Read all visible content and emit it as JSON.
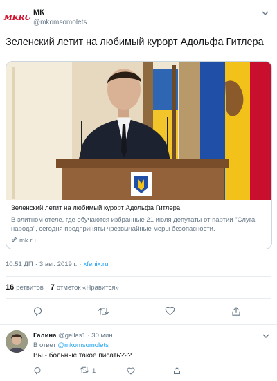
{
  "tweet": {
    "logo_text": "MKRU",
    "author_name": "МК",
    "author_handle": "@mkomsomolets",
    "text": "Зеленский летит на любимый курорт Адольфа Гитлера",
    "card": {
      "title": "Зеленский летит на любимый курорт Адольфа Гитлера",
      "description": "В элитном отеле, где обучаются избранные 21 июля депутаты от партии \"Слуга народа\", сегодня предприняты чрезвычайные меры безопасности.",
      "domain": "mk.ru"
    },
    "time": "10:51 ДП",
    "date": "3 авг. 2019 г.",
    "source": "xfenix.ru",
    "retweets_count": "16",
    "retweets_label": "ретвитов",
    "likes_count": "7",
    "likes_label": "отметок «Нравится»",
    "icons": {
      "reply": "reply-icon",
      "retweet": "retweet-icon",
      "like": "heart-icon",
      "share": "share-icon"
    }
  },
  "reply": {
    "author_name": "Галина",
    "author_handle": "@gellas1",
    "time": "30 мин",
    "reply_prefix": "В ответ",
    "reply_mention": "@mkomsomolets",
    "text": "Вы - больные такое писать???",
    "retweet_count": "1"
  },
  "colors": {
    "accent": "#1da1f2",
    "text_primary": "#14171a",
    "text_secondary": "#657786",
    "border": "#e6ecf0",
    "logo_red": "#d0112b"
  }
}
